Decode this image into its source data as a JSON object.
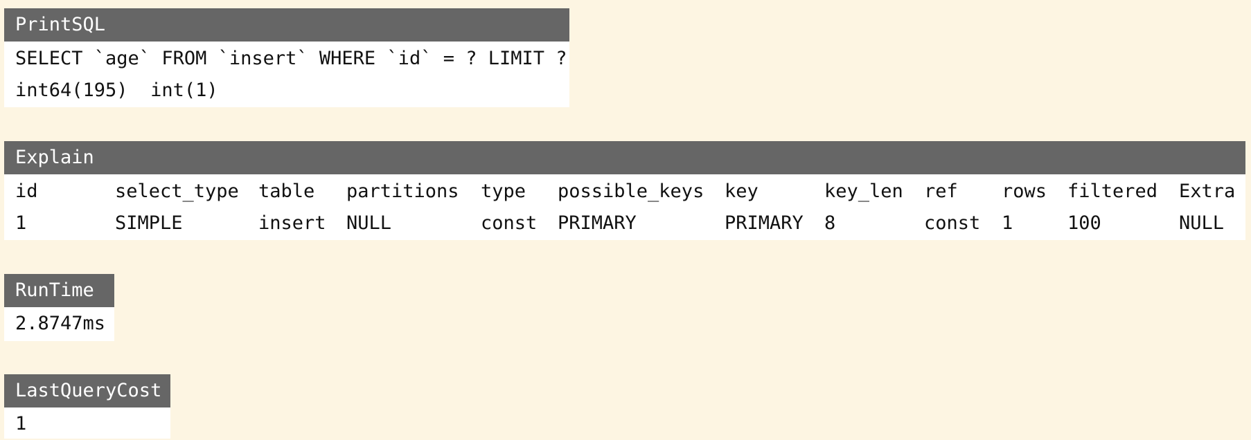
{
  "printsql": {
    "title": "PrintSQL",
    "sql": "SELECT `age` FROM `insert` WHERE `id` = ? LIMIT ?",
    "params": "int64(195)  int(1)"
  },
  "explain": {
    "title": "Explain",
    "columns": [
      "id",
      "select_type",
      "table",
      "partitions",
      "type",
      "possible_keys",
      "key",
      "key_len",
      "ref",
      "rows",
      "filtered",
      "Extra"
    ],
    "rows": [
      [
        "1",
        "SIMPLE",
        "insert",
        "NULL",
        "const",
        "PRIMARY",
        "PRIMARY",
        "8",
        "const",
        "1",
        "100",
        "NULL"
      ]
    ]
  },
  "runtime": {
    "title": "RunTime",
    "value": "2.8747ms"
  },
  "lastquerycost": {
    "title": "LastQueryCost",
    "value": "1"
  },
  "colors": {
    "background": "#fdf5e2",
    "header": "#666666",
    "panel": "#ffffff"
  }
}
